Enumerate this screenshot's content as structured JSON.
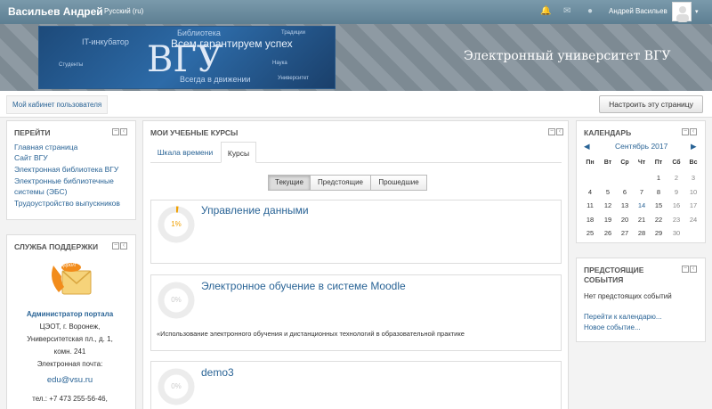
{
  "topbar": {
    "brand": "Васильев Андрей",
    "language": "Русский (ru)",
    "username": "Андрей Васильев",
    "caret": "▾"
  },
  "header": {
    "banner_big": "ВГУ",
    "banner_words": [
      "Библиотека",
      "Всем гарантируем успех",
      "IT-инкубатор",
      "Всегда в движении",
      "Традиции",
      "Наука",
      "Студенты",
      "Университет"
    ],
    "site_title": "Электронный университет ВГУ"
  },
  "breadcrumb": {
    "label": "Мой кабинет пользователя"
  },
  "customize_button": "Настроить эту страницу",
  "nav_block": {
    "title": "ПЕРЕЙТИ",
    "links": [
      "Главная страница",
      "Сайт ВГУ",
      "Электронная библиотека ВГУ",
      "Электронные библиотечные",
      "системы (ЭБС)",
      "Трудоустройство выпускников"
    ]
  },
  "support_block": {
    "title": "СЛУЖБА ПОДДЕРЖКИ",
    "logo_text": "Support",
    "admin": "Администратор портала",
    "addr1": "ЦЭОТ, г. Воронеж,",
    "addr2": "Университетская пл., д. 1,",
    "addr3": "комн. 241",
    "email_label": "Электронная почта:",
    "email": "edu@vsu.ru",
    "phone": "тел.: +7 473 255-56-46,"
  },
  "courses_block": {
    "title": "МОИ УЧЕБНЫЕ КУРСЫ",
    "tabs": [
      "Шкала времени",
      "Курсы"
    ],
    "filters": [
      "Текущие",
      "Предстоящие",
      "Прошедшие"
    ],
    "courses": [
      {
        "title": "Управление данными",
        "progress_label": "1%",
        "progress": 0.01,
        "desc": ""
      },
      {
        "title": "Электронное обучение в системе Moodle",
        "progress_label": "0%",
        "progress": 0,
        "desc": "«Использование электронного обучения и дистанционных технологий в образовательной практике"
      },
      {
        "title": "demo3",
        "progress_label": "0%",
        "progress": 0,
        "desc": ""
      }
    ]
  },
  "calendar_block": {
    "title": "КАЛЕНДАРЬ",
    "month": "Сентябрь 2017",
    "prev": "◀",
    "next": "▶",
    "dows": [
      "Пн",
      "Вт",
      "Ср",
      "Чт",
      "Пт",
      "Сб",
      "Вс"
    ],
    "weeks": [
      [
        "",
        "",
        "",
        "",
        "1",
        "2",
        "3"
      ],
      [
        "4",
        "5",
        "6",
        "7",
        "8",
        "9",
        "10"
      ],
      [
        "11",
        "12",
        "13",
        "14",
        "15",
        "16",
        "17"
      ],
      [
        "18",
        "19",
        "20",
        "21",
        "22",
        "23",
        "24"
      ],
      [
        "25",
        "26",
        "27",
        "28",
        "29",
        "30",
        ""
      ]
    ]
  },
  "events_block": {
    "title1": "ПРЕДСТОЯЩИЕ",
    "title2": "СОБЫТИЯ",
    "none": "Нет предстоящих событий",
    "goto": "Перейти к календарю...",
    "new": "Новое событие..."
  },
  "colors": {
    "navbar": "#6b8a9c",
    "link": "#2a6496",
    "progress": "#f0a000"
  }
}
